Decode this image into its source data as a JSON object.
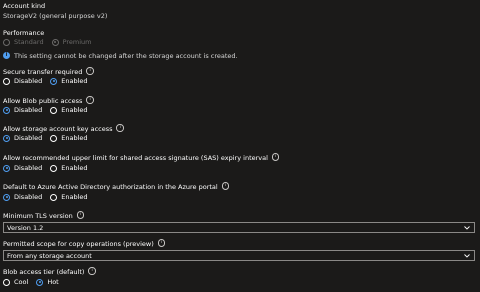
{
  "account_kind": {
    "label": "Account kind",
    "value": "StorageV2 (general purpose v2)"
  },
  "performance": {
    "label": "Performance",
    "options": [
      "Standard",
      "Premium"
    ],
    "note": "This setting cannot be changed after the storage account is created."
  },
  "secure_transfer": {
    "label": "Secure transfer required",
    "options": [
      "Disabled",
      "Enabled"
    ]
  },
  "blob_public_access": {
    "label": "Allow Blob public access",
    "options": [
      "Disabled",
      "Enabled"
    ]
  },
  "storage_key_access": {
    "label": "Allow storage account key access",
    "options": [
      "Disabled",
      "Enabled"
    ]
  },
  "sas_expiry": {
    "label": "Allow recommended upper limit for shared access signature (SAS) expiry interval",
    "options": [
      "Disabled",
      "Enabled"
    ]
  },
  "aad_default": {
    "label": "Default to Azure Active Directory authorization in the Azure portal",
    "options": [
      "Disabled",
      "Enabled"
    ]
  },
  "tls": {
    "label": "Minimum TLS version",
    "value": "Version 1.2"
  },
  "copy_scope": {
    "label": "Permitted scope for copy operations (preview)",
    "value": "From any storage account"
  },
  "access_tier": {
    "label": "Blob access tier (default)",
    "options": [
      "Cool",
      "Hot"
    ]
  },
  "colors": {
    "accent": "#4f9df0",
    "background": "#1b1a19",
    "disabled": "#6b6a69"
  },
  "icons": {
    "info": "i",
    "chevron": "chevron-down-icon"
  }
}
